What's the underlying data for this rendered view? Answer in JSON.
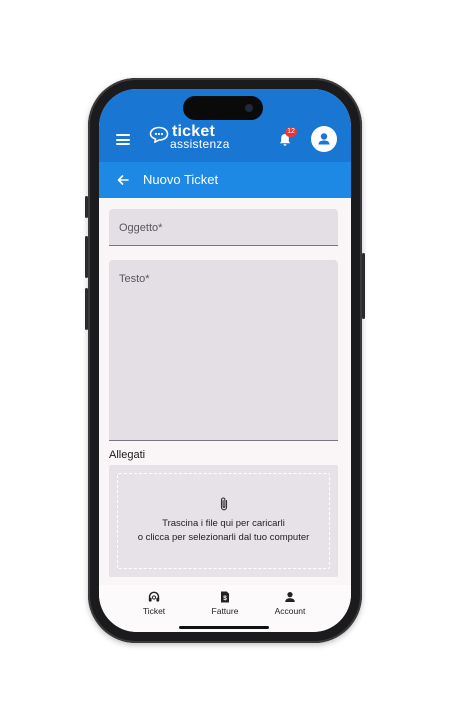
{
  "app": {
    "logo_line1": "ticket",
    "logo_line2": "assistenza",
    "notification_count": "12"
  },
  "header": {
    "title": "Nuovo Ticket"
  },
  "form": {
    "subject_label": "Oggetto*",
    "text_label": "Testo*",
    "attachments_heading": "Allegati",
    "dropzone_line1": "Trascina i file qui per caricarli",
    "dropzone_line2": "o clicca per selezionarli dal tuo computer"
  },
  "bottom_nav": {
    "items": [
      {
        "label": "Ticket",
        "icon": "headset-icon"
      },
      {
        "label": "Fatture",
        "icon": "invoice-icon"
      },
      {
        "label": "Account",
        "icon": "person-icon"
      }
    ]
  },
  "colors": {
    "appbar": "#1976d2",
    "subbar": "#1e88e5",
    "field_bg": "#e3dfe4",
    "badge": "#e53935"
  }
}
